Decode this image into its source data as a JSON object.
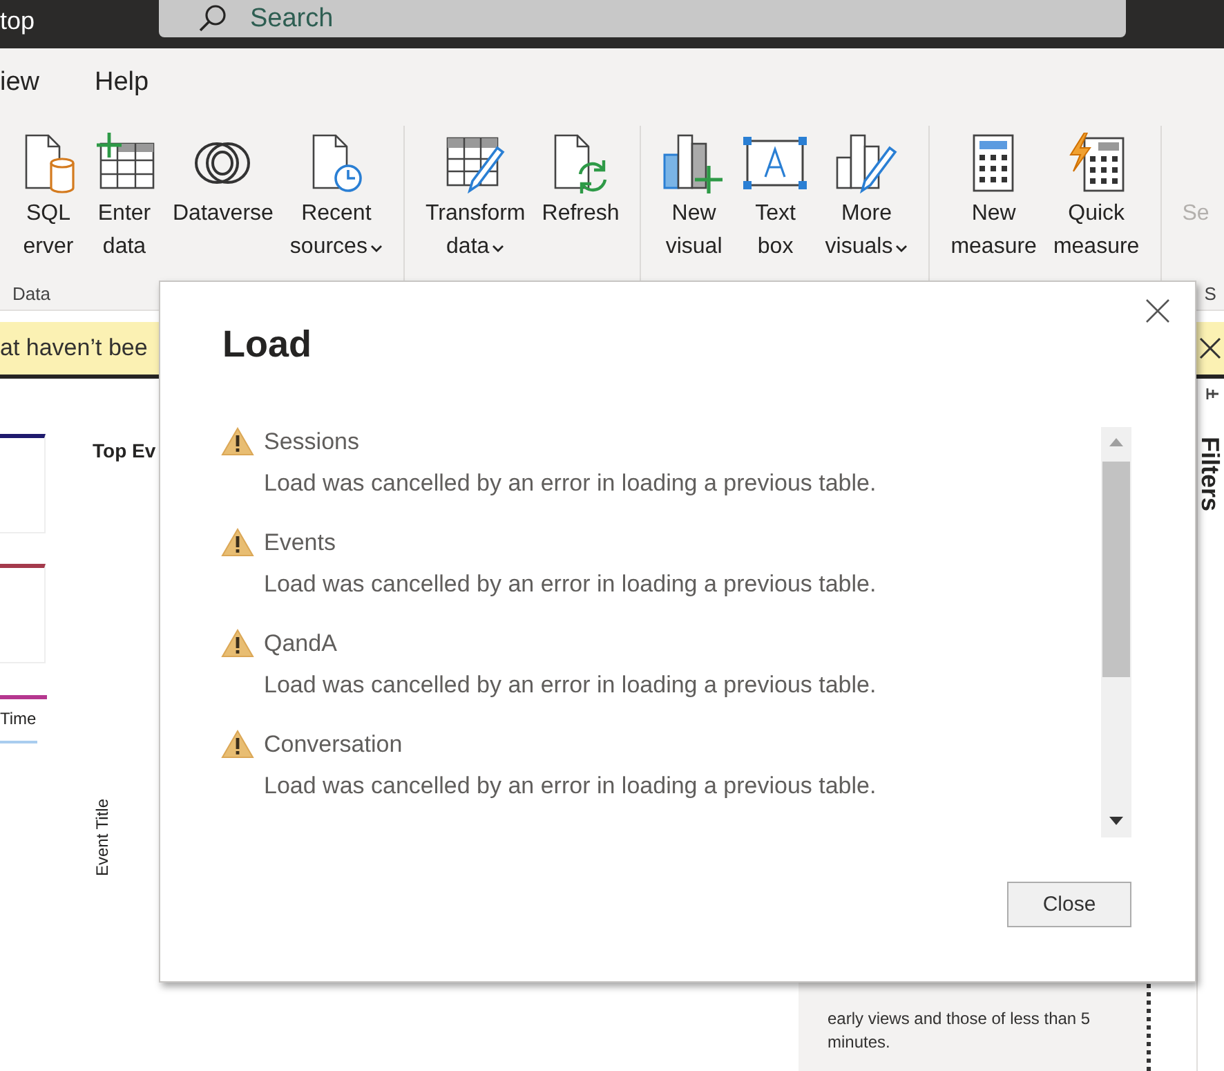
{
  "window": {
    "title": "top"
  },
  "search": {
    "placeholder": "Search"
  },
  "menu": [
    {
      "label": "iew"
    },
    {
      "label": "Help"
    }
  ],
  "ribbon": {
    "groups": [
      {
        "label": "Data",
        "buttons": [
          {
            "kind": "database",
            "lines": [
              "SQL",
              "erver"
            ],
            "dropdown": false,
            "disabled": false
          },
          {
            "kind": "table",
            "lines": [
              "Enter",
              "data"
            ],
            "dropdown": false,
            "disabled": false
          },
          {
            "kind": "swirl",
            "lines": [
              "Dataverse"
            ],
            "dropdown": false,
            "disabled": false
          },
          {
            "kind": "recent",
            "lines": [
              "Recent",
              "sources"
            ],
            "dropdown": true,
            "disabled": false
          }
        ]
      },
      {
        "buttons": [
          {
            "kind": "transform",
            "lines": [
              "Transform",
              "data"
            ],
            "dropdown": true,
            "disabled": false
          },
          {
            "kind": "refresh",
            "lines": [
              "Refresh"
            ],
            "dropdown": false,
            "disabled": false
          }
        ]
      },
      {
        "buttons": [
          {
            "kind": "visual",
            "lines": [
              "New",
              "visual"
            ],
            "dropdown": false,
            "disabled": false
          },
          {
            "kind": "textbox",
            "lines": [
              "Text",
              "box"
            ],
            "dropdown": false,
            "disabled": false
          },
          {
            "kind": "morevisuals",
            "lines": [
              "More",
              "visuals"
            ],
            "dropdown": true,
            "disabled": false
          }
        ]
      },
      {
        "buttons": [
          {
            "kind": "calculator",
            "lines": [
              "New",
              "measure"
            ],
            "dropdown": false,
            "disabled": false
          },
          {
            "kind": "quickmeasure",
            "lines": [
              "Quick",
              "measure"
            ],
            "dropdown": false,
            "disabled": false
          }
        ]
      },
      {
        "label": "S",
        "buttons": [
          {
            "kind": "plain",
            "lines": [
              "Se"
            ],
            "dropdown": false,
            "disabled": true
          }
        ]
      }
    ]
  },
  "banner": {
    "text": "at haven’t bee"
  },
  "canvas": {
    "title": "Top Ev",
    "axis_label": "Event Title",
    "legend_label": "Time",
    "note": "early views and those of less than 5 minutes."
  },
  "filters": {
    "title": "Filters"
  },
  "dialog": {
    "title": "Load",
    "items": [
      {
        "name": "Sessions",
        "message": "Load was cancelled by an error in loading a previous table."
      },
      {
        "name": "Events",
        "message": "Load was cancelled by an error in loading a previous table."
      },
      {
        "name": "QandA",
        "message": "Load was cancelled by an error in loading a previous table."
      },
      {
        "name": "Conversation",
        "message": "Load was cancelled by an error in loading a previous table."
      }
    ],
    "button": "Close"
  }
}
